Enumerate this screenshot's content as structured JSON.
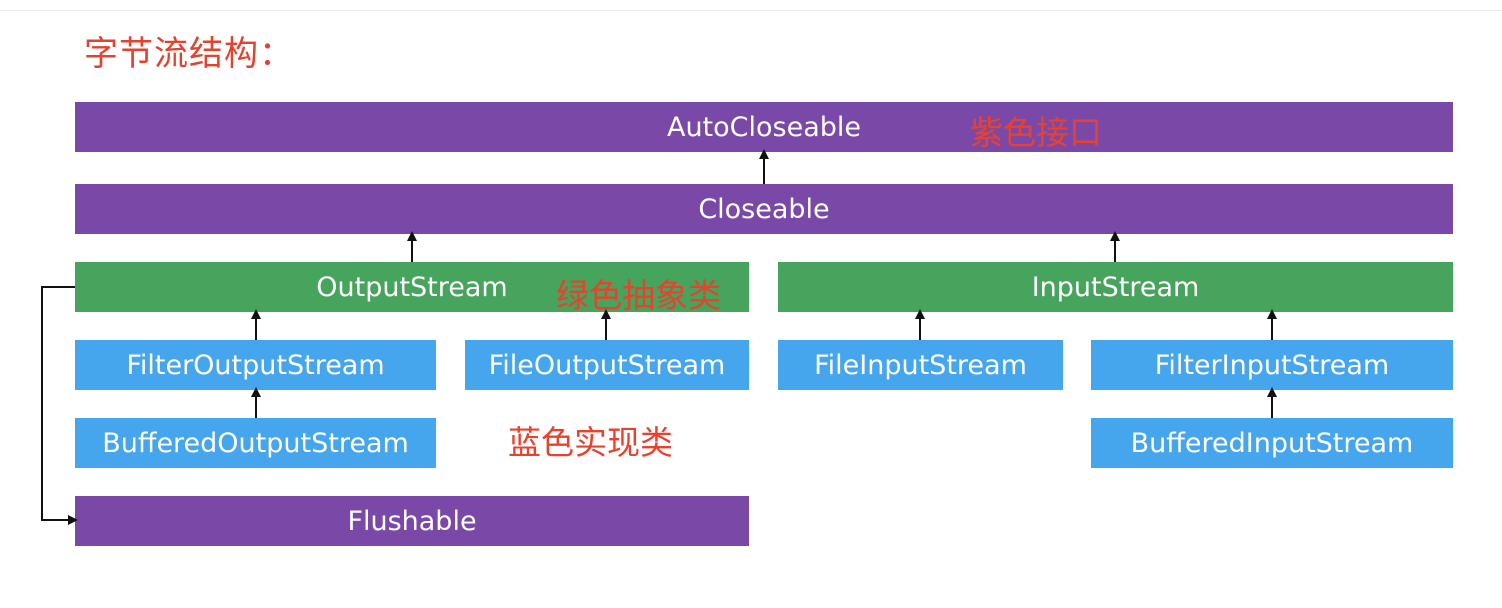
{
  "title": "字节流结构：",
  "nodes": {
    "autocloseable": "AutoCloseable",
    "closeable": "Closeable",
    "outputstream": "OutputStream",
    "inputstream": "InputStream",
    "filteroutputstream": "FilterOutputStream",
    "fileoutputstream": "FileOutputStream",
    "fileinputstream": "FileInputStream",
    "filterinputstream": "FilterInputStream",
    "bufferedoutputstream": "BufferedOutputStream",
    "bufferedinputstream": "BufferedInputStream",
    "flushable": "Flushable"
  },
  "legend": {
    "purple": "紫色接口",
    "green": "绿色抽象类",
    "blue": "蓝色实现类"
  },
  "colors": {
    "interface": "#7a49a8",
    "abstract_class": "#46a45c",
    "implementation_class": "#45a5ed",
    "annotation_text": "#e8422e"
  }
}
